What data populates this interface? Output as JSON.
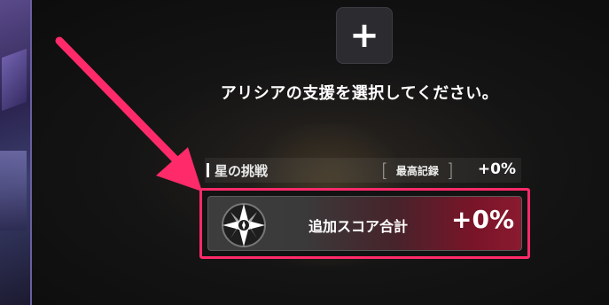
{
  "support": {
    "add_icon": "plus-icon",
    "instruction": "アリシアの支援を選択してください。"
  },
  "challenge": {
    "title": "星の挑戦",
    "record_label": "最高記録",
    "record_value": "+0%"
  },
  "total_score": {
    "emblem_icon": "star-emblem-icon",
    "label": "追加スコア合計",
    "value": "+0%"
  },
  "colors": {
    "highlight": "#ff2a6a",
    "background": "#141414"
  }
}
